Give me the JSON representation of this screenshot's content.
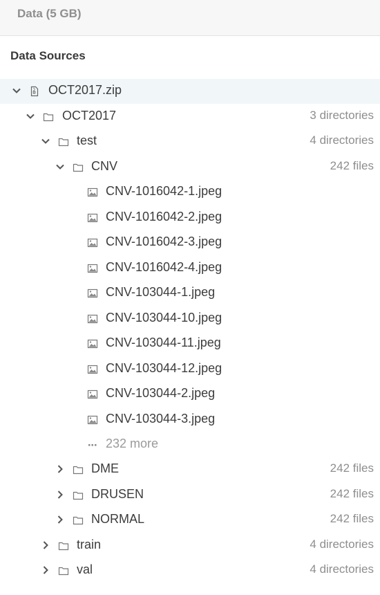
{
  "header": {
    "title": "Data (5 GB)"
  },
  "section": {
    "title": "Data Sources"
  },
  "tree": {
    "root_zip": {
      "name": "OCT2017.zip"
    },
    "oct2017": {
      "name": "OCT2017",
      "meta": "3 directories"
    },
    "test": {
      "name": "test",
      "meta": "4 directories"
    },
    "cnv": {
      "name": "CNV",
      "meta": "242 files"
    },
    "cnv_files": [
      "CNV-1016042-1.jpeg",
      "CNV-1016042-2.jpeg",
      "CNV-1016042-3.jpeg",
      "CNV-1016042-4.jpeg",
      "CNV-103044-1.jpeg",
      "CNV-103044-10.jpeg",
      "CNV-103044-11.jpeg",
      "CNV-103044-12.jpeg",
      "CNV-103044-2.jpeg",
      "CNV-103044-3.jpeg"
    ],
    "more": {
      "label": "232 more"
    },
    "dme": {
      "name": "DME",
      "meta": "242 files"
    },
    "drusen": {
      "name": "DRUSEN",
      "meta": "242 files"
    },
    "normal": {
      "name": "NORMAL",
      "meta": "242 files"
    },
    "train": {
      "name": "train",
      "meta": "4 directories"
    },
    "val": {
      "name": "val",
      "meta": "4 directories"
    }
  },
  "icons": {
    "expanded": "chevron-down-icon",
    "collapsed": "chevron-right-icon",
    "zip": "zip-file-icon",
    "folder": "folder-icon",
    "image": "image-file-icon",
    "more": "ellipsis-icon"
  },
  "colors": {
    "selected_row": "#f1f6f8",
    "header_bg": "#f7f7f7",
    "muted_text": "#8e8e8e"
  }
}
